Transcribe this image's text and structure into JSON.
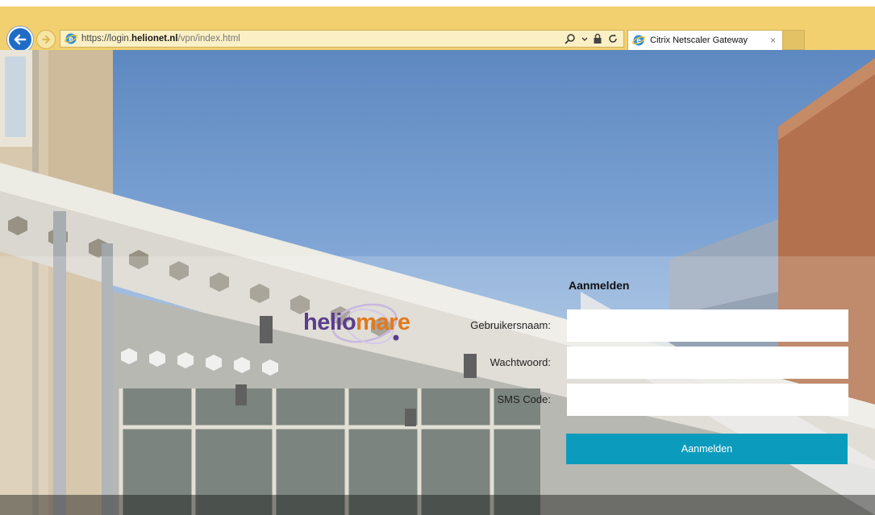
{
  "browser": {
    "url_prefix": "https://login.",
    "url_domain": "helionet.nl",
    "url_path": "/vpn/index.html",
    "tab_title": "Citrix Netscaler Gateway",
    "tab_close": "×"
  },
  "logo": {
    "part1": "helio",
    "part2": "mare"
  },
  "form": {
    "title": "Aanmelden",
    "username_label": "Gebruikersnaam:",
    "password_label": "Wachtwoord:",
    "sms_label": "SMS Code:",
    "username_value": "",
    "password_value": "",
    "sms_value": "",
    "submit_label": "Aanmelden"
  },
  "colors": {
    "chrome": "#f2d06f",
    "submit": "#0b9cbd",
    "logo_purple": "#5a3d8c",
    "logo_orange": "#e07a1f"
  }
}
